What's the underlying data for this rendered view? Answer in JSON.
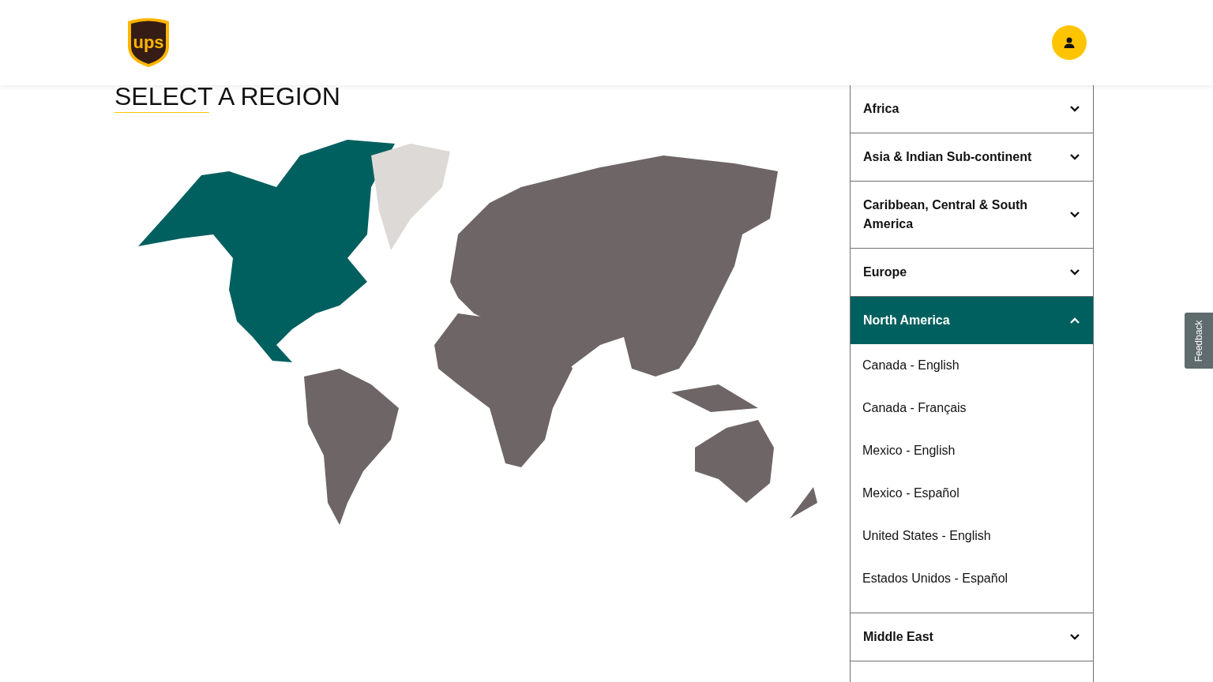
{
  "header": {
    "logo": {
      "text": "ups"
    }
  },
  "title": "SELECT A REGION",
  "regions": [
    {
      "label": "Africa",
      "expanded": false
    },
    {
      "label": "Asia & Indian Sub-continent",
      "expanded": false
    },
    {
      "label": "Caribbean, Central & South America",
      "expanded": false
    },
    {
      "label": "Europe",
      "expanded": false
    },
    {
      "label": "North America",
      "expanded": true,
      "children": [
        {
          "label": "Canada - English"
        },
        {
          "label": "Canada - Français"
        },
        {
          "label": "Mexico - English"
        },
        {
          "label": "Mexico - Español"
        },
        {
          "label": "United States - English"
        },
        {
          "label": "Estados Unidos - Español"
        }
      ]
    },
    {
      "label": "Middle East",
      "expanded": false
    }
  ],
  "feedback_tab": "Feedback"
}
